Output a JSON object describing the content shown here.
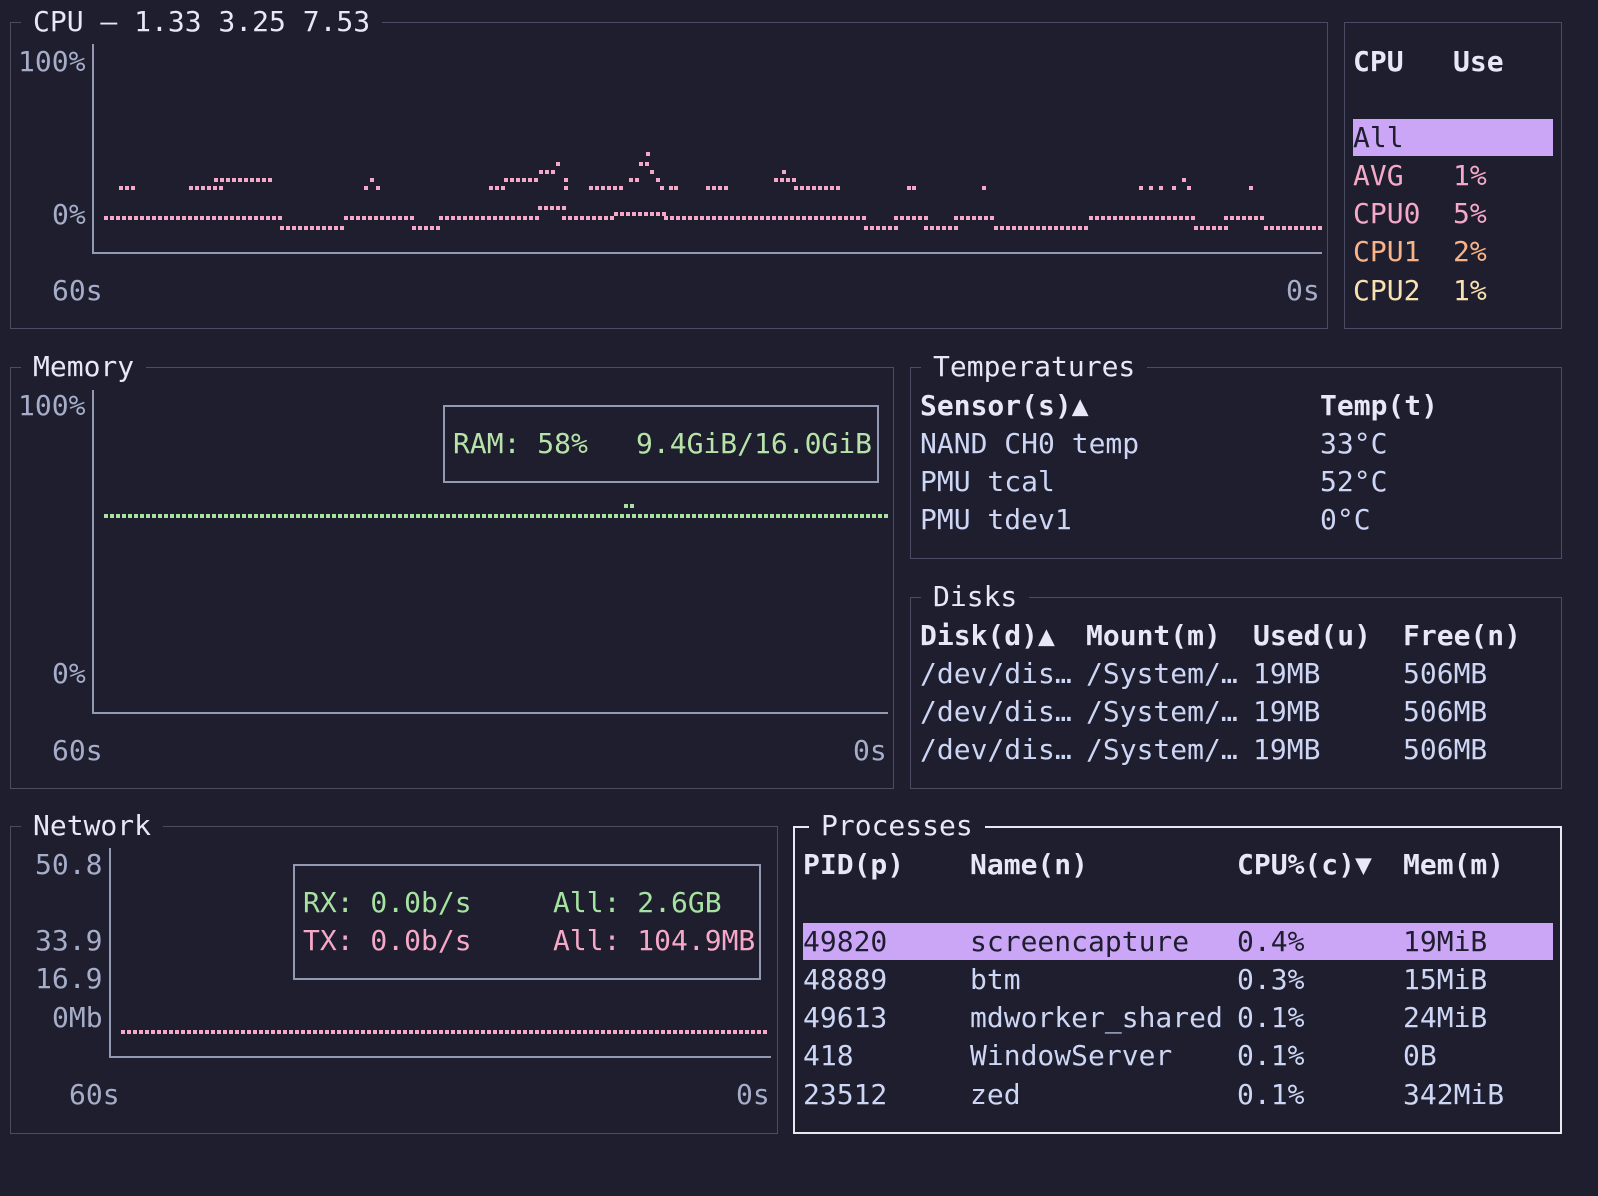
{
  "cpu": {
    "title": "CPU — 1.33 3.25 7.53",
    "y_top": "100%",
    "y_bottom": "0%",
    "x_left": "60s",
    "x_right": "0s",
    "legend": {
      "col_cpu": "CPU",
      "col_use": "Use",
      "rows": [
        {
          "name": "All",
          "use": ""
        },
        {
          "name": "AVG",
          "use": "1%"
        },
        {
          "name": "CPU0",
          "use": "5%"
        },
        {
          "name": "CPU1",
          "use": "2%"
        },
        {
          "name": "CPU2",
          "use": "1%"
        }
      ]
    }
  },
  "memory": {
    "title": "Memory",
    "y_top": "100%",
    "y_bottom": "0%",
    "x_left": "60s",
    "x_right": "0s",
    "ram_label": "RAM: 58%",
    "ram_value": "9.4GiB/16.0GiB"
  },
  "temperatures": {
    "title": "Temperatures",
    "col_sensor": "Sensor(s)▲",
    "col_temp": "Temp(t)",
    "rows": [
      {
        "sensor": "NAND CH0 temp",
        "temp": "33°C"
      },
      {
        "sensor": "PMU tcal",
        "temp": "52°C"
      },
      {
        "sensor": "PMU tdev1",
        "temp": "0°C"
      }
    ]
  },
  "disks": {
    "title": "Disks",
    "columns": [
      "Disk(d)▲",
      "Mount(m)",
      "Used(u)",
      "Free(n)"
    ],
    "rows": [
      [
        "/dev/dis…",
        "/System/…",
        "19MB",
        "506MB"
      ],
      [
        "/dev/dis…",
        "/System/…",
        "19MB",
        "506MB"
      ],
      [
        "/dev/dis…",
        "/System/…",
        "19MB",
        "506MB"
      ]
    ]
  },
  "network": {
    "title": "Network",
    "y_labels": [
      "50.8",
      "33.9",
      "16.9",
      "0Mb"
    ],
    "x_left": "60s",
    "x_right": "0s",
    "rx_label": "RX: 0.0b/s",
    "rx_total": "All: 2.6GB",
    "tx_label": "TX: 0.0b/s",
    "tx_total": "All: 104.9MB"
  },
  "processes": {
    "title": "Processes",
    "columns": [
      "PID(p)",
      "Name(n)",
      "CPU%(c)▼",
      "Mem(m)"
    ],
    "rows": [
      [
        "49820",
        "screencapture",
        "0.4%",
        "19MiB"
      ],
      [
        "48889",
        "btm",
        "0.3%",
        "15MiB"
      ],
      [
        "49613",
        "mdworker_shared",
        "0.1%",
        "24MiB"
      ],
      [
        "418",
        "WindowServer",
        "0.1%",
        "0B"
      ],
      [
        "23512",
        "zed",
        "0.1%",
        "342MiB"
      ]
    ]
  },
  "colors": {
    "background": "#1e1e2e",
    "selection": "#cba6f7",
    "cpu_line": "#f5a8c7",
    "memory_line": "#a6e3a1",
    "network_line": "#f5a8c7"
  }
}
